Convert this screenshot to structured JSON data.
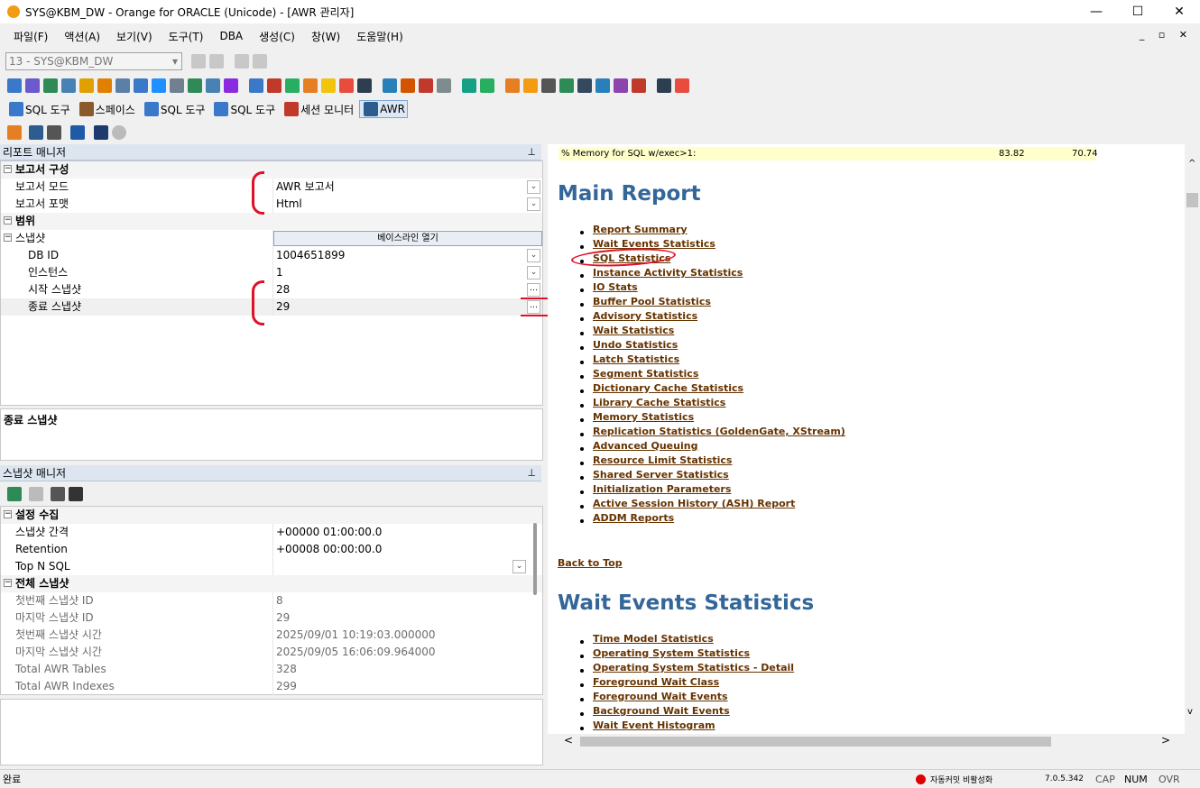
{
  "window": {
    "title": "SYS@KBM_DW - Orange for ORACLE (Unicode) - [AWR 관리자]",
    "min": "—",
    "max": "☐",
    "close": "✕"
  },
  "menu": [
    "파일(F)",
    "액션(A)",
    "보기(V)",
    "도구(T)",
    "DBA",
    "생성(C)",
    "창(W)",
    "도움말(H)"
  ],
  "mdi_controls": "_ ▫ ✕",
  "connection": {
    "value": "13 - SYS@KBM_DW"
  },
  "tabs": [
    {
      "label": "SQL 도구",
      "icon": "sql-icon"
    },
    {
      "label": "스페이스",
      "icon": "space-icon"
    },
    {
      "label": "SQL 도구",
      "icon": "sql-icon"
    },
    {
      "label": "SQL 도구",
      "icon": "sql-icon"
    },
    {
      "label": "세션 모니터",
      "icon": "session-icon"
    },
    {
      "label": "AWR",
      "icon": "awr-icon"
    }
  ],
  "report_manager": {
    "title": "리포트 매니저",
    "pin": "⊥",
    "cat_config": "보고서 구성",
    "mode_label": "보고서 모드",
    "mode_value": "AWR 보고서",
    "format_label": "보고서 포맷",
    "format_value": "Html",
    "cat_range": "범위",
    "snapshot_label": "스냅샷",
    "baseline_button": "베이스라인 열기",
    "dbid_label": "DB ID",
    "dbid_value": "1004651899",
    "instance_label": "인스턴스",
    "instance_value": "1",
    "start_label": "시작 스냅샷",
    "start_value": "28",
    "end_label": "종료 스냅샷",
    "end_value": "29",
    "desc_title": "종료 스냅샷"
  },
  "snapshot_manager": {
    "title": "스냅샷 매니저",
    "cat_settings": "설정 수집",
    "interval_label": "스냅샷 간격",
    "interval_value": "+00000 01:00:00.0",
    "retention_label": "Retention",
    "retention_value": "+00008 00:00:00.0",
    "topn_label": "Top N SQL",
    "topn_value": "",
    "cat_all": "전체 스냅샷",
    "first_id_label": "첫번째 스냅샷 ID",
    "first_id_value": "8",
    "last_id_label": "마지막 스냅샷 ID",
    "last_id_value": "29",
    "first_time_label": "첫번째 스냅샷 시간",
    "first_time_value": "2025/09/01 10:19:03.000000",
    "last_time_label": "마지막 스냅샷 시간",
    "last_time_value": "2025/09/05 16:06:09.964000",
    "tables_label": "Total AWR Tables",
    "tables_value": "328",
    "indexes_label": "Total AWR Indexes",
    "indexes_value": "299"
  },
  "report": {
    "mem_label": "% Memory for SQL w/exec>1:",
    "mem_v1": "83.82",
    "mem_v2": "70.74",
    "main_title": "Main Report",
    "main_links": [
      "Report Summary",
      "Wait Events Statistics",
      "SQL Statistics",
      "Instance Activity Statistics",
      "IO Stats",
      "Buffer Pool Statistics",
      "Advisory Statistics",
      "Wait Statistics",
      "Undo Statistics",
      "Latch Statistics",
      "Segment Statistics",
      "Dictionary Cache Statistics",
      "Library Cache Statistics",
      "Memory Statistics",
      "Replication Statistics (GoldenGate, XStream)",
      "Advanced Queuing",
      "Resource Limit Statistics",
      "Shared Server Statistics",
      "Initialization Parameters",
      "Active Session History (ASH) Report",
      "ADDM Reports"
    ],
    "back_to_top": "Back to Top",
    "wait_title": "Wait Events Statistics",
    "wait_links": [
      "Time Model Statistics",
      "Operating System Statistics",
      "Operating System Statistics - Detail",
      "Foreground Wait Class",
      "Foreground Wait Events",
      "Background Wait Events",
      "Wait Event Histogram"
    ]
  },
  "status": {
    "left": "완료",
    "autocommit": "자동커밋 비활성화",
    "version": "7.0.5.342",
    "cap": "CAP",
    "num": "NUM",
    "ovr": "OVR",
    "autocommit_color": "#e00000"
  }
}
